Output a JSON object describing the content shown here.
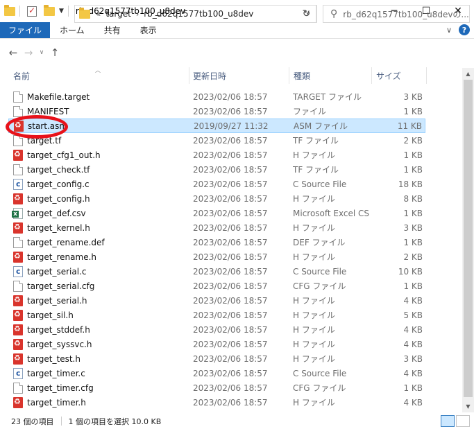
{
  "window": {
    "title": "rb_d62q1577tb100_u8dev",
    "minimize": "─",
    "maximize": "☐",
    "close": "✕"
  },
  "ribbon": {
    "tabs": [
      "ファイル",
      "ホーム",
      "共有",
      "表示"
    ],
    "expand": "∨",
    "help": "?"
  },
  "address": {
    "back": "←",
    "forward": "→",
    "recent": "∨",
    "up": "↑",
    "overflow": "«",
    "crumbs": [
      "target",
      "rb_d62q1577tb100_u8dev"
    ],
    "crumb_sep": "›",
    "dropdown": "∨",
    "refresh": "↻",
    "search_placeholder": "rb_d62q1577tb100_u8devの..."
  },
  "columns": {
    "name": "名前",
    "date": "更新日時",
    "type": "種類",
    "size": "サイズ"
  },
  "files": [
    {
      "name": "Makefile.target",
      "date": "2023/02/06 18:57",
      "type": "TARGET ファイル",
      "size": "3 KB",
      "icon": "blank"
    },
    {
      "name": "MANIFEST",
      "date": "2023/02/06 18:57",
      "type": "ファイル",
      "size": "1 KB",
      "icon": "blank"
    },
    {
      "name": "start.asm",
      "date": "2019/09/27 11:32",
      "type": "ASM ファイル",
      "size": "11 KB",
      "icon": "red"
    },
    {
      "name": "target.tf",
      "date": "2023/02/06 18:57",
      "type": "TF ファイル",
      "size": "2 KB",
      "icon": "blank"
    },
    {
      "name": "target_cfg1_out.h",
      "date": "2023/02/06 18:57",
      "type": "H ファイル",
      "size": "1 KB",
      "icon": "red"
    },
    {
      "name": "target_check.tf",
      "date": "2023/02/06 18:57",
      "type": "TF ファイル",
      "size": "1 KB",
      "icon": "blank"
    },
    {
      "name": "target_config.c",
      "date": "2023/02/06 18:57",
      "type": "C Source File",
      "size": "18 KB",
      "icon": "c"
    },
    {
      "name": "target_config.h",
      "date": "2023/02/06 18:57",
      "type": "H ファイル",
      "size": "8 KB",
      "icon": "red"
    },
    {
      "name": "target_def.csv",
      "date": "2023/02/06 18:57",
      "type": "Microsoft Excel CS...",
      "size": "1 KB",
      "icon": "xls"
    },
    {
      "name": "target_kernel.h",
      "date": "2023/02/06 18:57",
      "type": "H ファイル",
      "size": "3 KB",
      "icon": "red"
    },
    {
      "name": "target_rename.def",
      "date": "2023/02/06 18:57",
      "type": "DEF ファイル",
      "size": "1 KB",
      "icon": "blank"
    },
    {
      "name": "target_rename.h",
      "date": "2023/02/06 18:57",
      "type": "H ファイル",
      "size": "2 KB",
      "icon": "red"
    },
    {
      "name": "target_serial.c",
      "date": "2023/02/06 18:57",
      "type": "C Source File",
      "size": "10 KB",
      "icon": "c"
    },
    {
      "name": "target_serial.cfg",
      "date": "2023/02/06 18:57",
      "type": "CFG ファイル",
      "size": "1 KB",
      "icon": "blank"
    },
    {
      "name": "target_serial.h",
      "date": "2023/02/06 18:57",
      "type": "H ファイル",
      "size": "4 KB",
      "icon": "red"
    },
    {
      "name": "target_sil.h",
      "date": "2023/02/06 18:57",
      "type": "H ファイル",
      "size": "5 KB",
      "icon": "red"
    },
    {
      "name": "target_stddef.h",
      "date": "2023/02/06 18:57",
      "type": "H ファイル",
      "size": "4 KB",
      "icon": "red"
    },
    {
      "name": "target_syssvc.h",
      "date": "2023/02/06 18:57",
      "type": "H ファイル",
      "size": "4 KB",
      "icon": "red"
    },
    {
      "name": "target_test.h",
      "date": "2023/02/06 18:57",
      "type": "H ファイル",
      "size": "3 KB",
      "icon": "red"
    },
    {
      "name": "target_timer.c",
      "date": "2023/02/06 18:57",
      "type": "C Source File",
      "size": "4 KB",
      "icon": "c"
    },
    {
      "name": "target_timer.cfg",
      "date": "2023/02/06 18:57",
      "type": "CFG ファイル",
      "size": "1 KB",
      "icon": "blank"
    },
    {
      "name": "target_timer.h",
      "date": "2023/02/06 18:57",
      "type": "H ファイル",
      "size": "4 KB",
      "icon": "red"
    }
  ],
  "selected_index": 2,
  "status": {
    "item_count": "23 個の項目",
    "selection": "1 個の項目を選択  10.0 KB"
  },
  "colors": {
    "accent": "#1e69b9",
    "selection": "#cce8ff",
    "annotation": "#e8121a"
  }
}
